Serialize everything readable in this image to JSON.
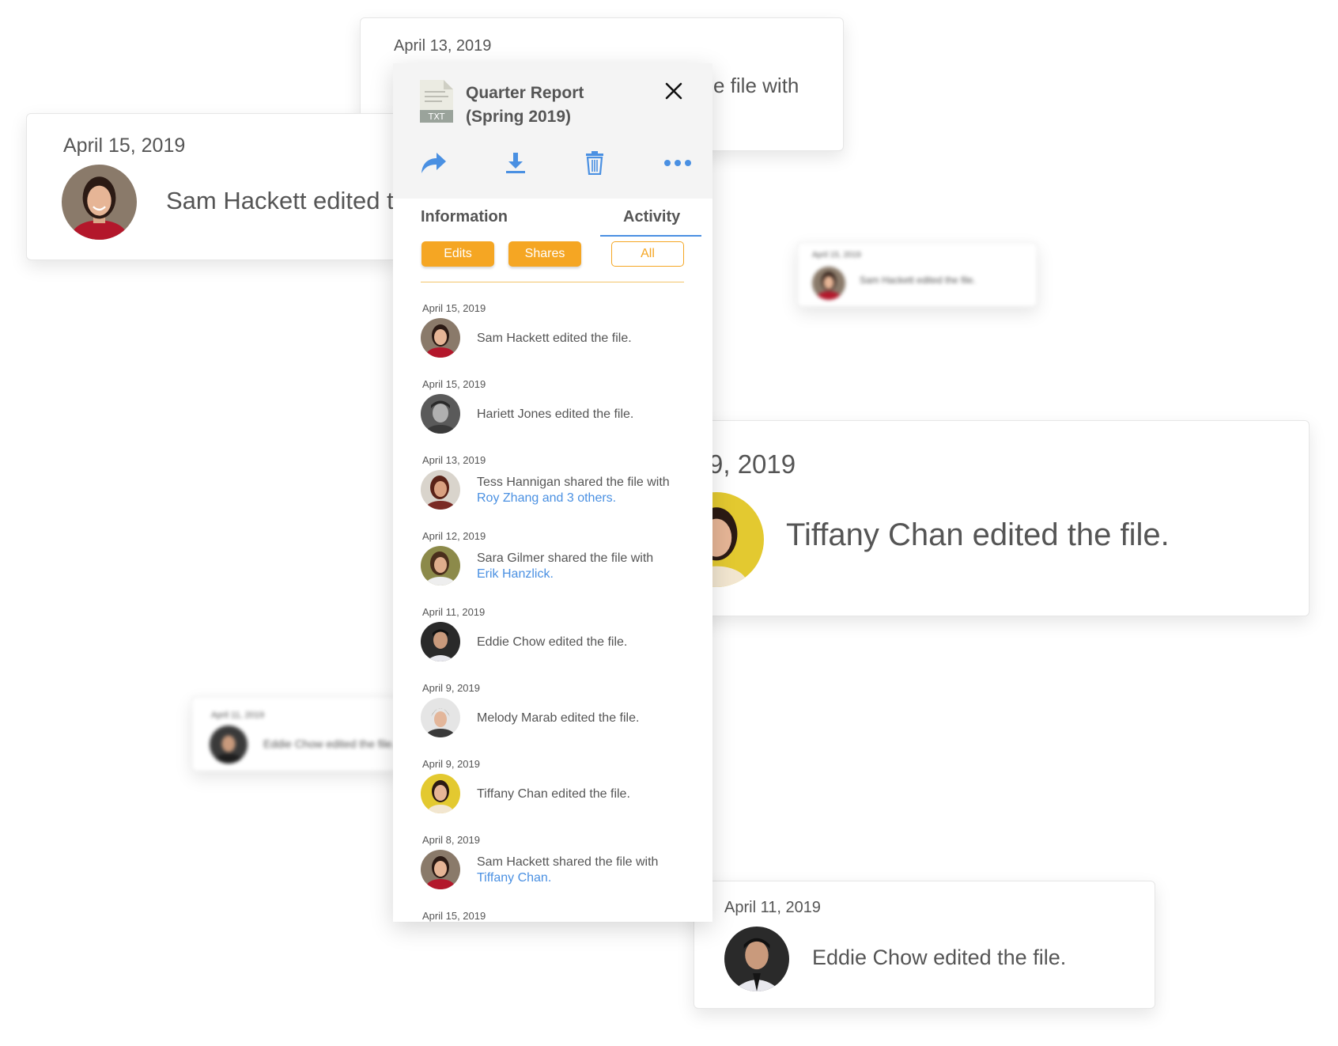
{
  "bg_cards": {
    "apr13": {
      "date": "April 13, 2019",
      "msg": "e file with"
    },
    "apr15": {
      "date": "April 15, 2019",
      "msg": "Sam Hackett edited tl"
    },
    "blur_top": {
      "date": "April 15, 2019",
      "msg": "Sam Hackett edited the file."
    },
    "blur_left": {
      "date": "April 11, 2019",
      "msg": "Eddie Chow edited the file."
    },
    "apr9": {
      "date": "9, 2019",
      "msg": "Tiffany Chan edited the file."
    },
    "apr11": {
      "date": "April 11, 2019",
      "msg": "Eddie Chow edited the file."
    }
  },
  "panel": {
    "file": {
      "icon_label": "TXT",
      "title_line1": "Quarter Report",
      "title_line2": "(Spring 2019)"
    },
    "actions": [
      "share-icon",
      "download-icon",
      "trash-icon",
      "more-icon"
    ],
    "tabs": {
      "information": "Information",
      "activity": "Activity"
    },
    "filters": {
      "edits": "Edits",
      "shares": "Shares",
      "all": "All"
    },
    "colors": {
      "accent": "#4a90e2",
      "orange": "#f5a623"
    }
  },
  "feed": [
    {
      "date": "April 15, 2019",
      "text": "Sam Hackett edited the file.",
      "link": ""
    },
    {
      "date": "April 15, 2019",
      "text": "Hariett Jones edited the file.",
      "link": ""
    },
    {
      "date": "April 13, 2019",
      "text": "Tess Hannigan shared the file with",
      "link": "Roy Zhang and 3 others."
    },
    {
      "date": "April 12, 2019",
      "text": "Sara Gilmer shared the file with",
      "link": "Erik Hanzlick."
    },
    {
      "date": "April 11, 2019",
      "text": "Eddie Chow edited the file.",
      "link": ""
    },
    {
      "date": "April 9, 2019",
      "text": "Melody Marab edited the file.",
      "link": ""
    },
    {
      "date": "April 9, 2019",
      "text": "Tiffany Chan edited the file.",
      "link": ""
    },
    {
      "date": "April 8, 2019",
      "text": "Sam Hackett shared the file with",
      "link": "Tiffany Chan."
    },
    {
      "date": "April 15, 2019",
      "text": "",
      "link": ""
    }
  ]
}
